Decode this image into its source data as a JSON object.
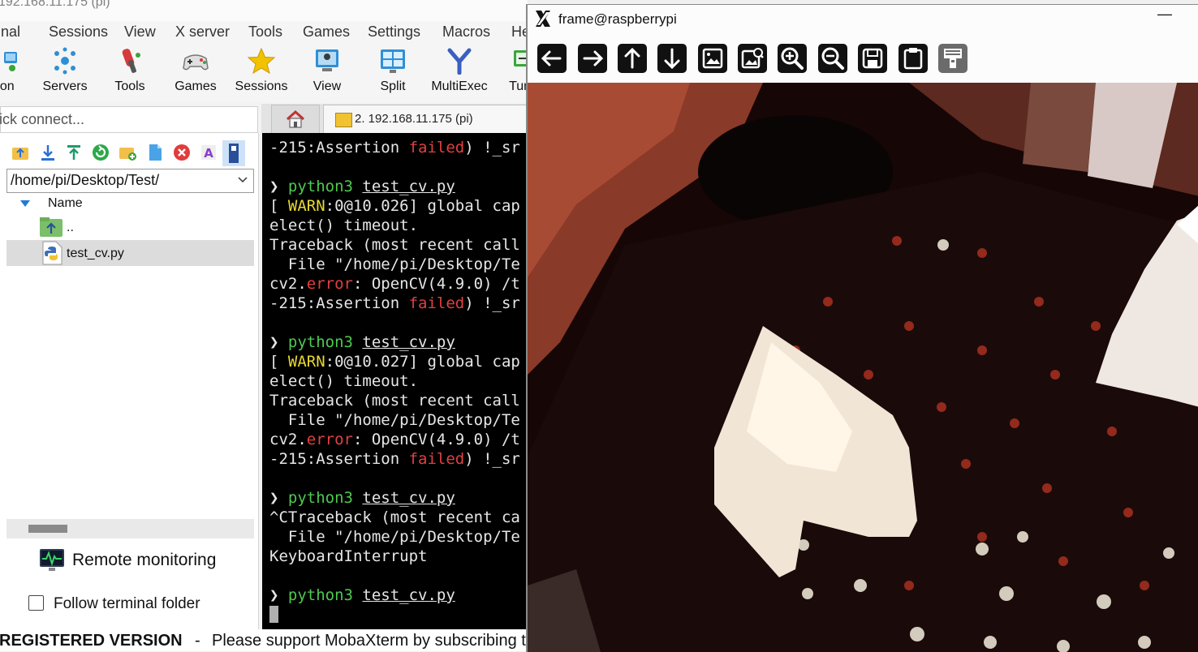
{
  "moba": {
    "title": "192.168.11.175 (pi)",
    "menu": [
      "inal",
      "Sessions",
      "View",
      "X server",
      "Tools",
      "Games",
      "Settings",
      "Macros",
      "He"
    ],
    "ribbon": [
      {
        "label": "sion",
        "icon": "session-icon"
      },
      {
        "label": "Servers",
        "icon": "servers-icon"
      },
      {
        "label": "Tools",
        "icon": "tools-icon"
      },
      {
        "label": "Games",
        "icon": "games-icon"
      },
      {
        "label": "Sessions",
        "icon": "sessions-star-icon"
      },
      {
        "label": "View",
        "icon": "view-icon"
      },
      {
        "label": "Split",
        "icon": "split-icon"
      },
      {
        "label": "MultiExec",
        "icon": "multiexec-icon"
      },
      {
        "label": "Tunn",
        "icon": "tunneling-icon"
      }
    ],
    "quick_connect_placeholder": "ick connect...",
    "tab_label": "2. 192.168.11.175 (pi)",
    "sftp": {
      "path": "/home/pi/Desktop/Test/",
      "column_name": "Name",
      "files": [
        {
          "name": "..",
          "icon": "parent-folder-icon"
        },
        {
          "name": "test_cv.py",
          "icon": "python-file-icon"
        }
      ],
      "remote_monitoring": "Remote monitoring",
      "follow_terminal_folder": "Follow terminal folder",
      "follow_checked": false
    },
    "status": {
      "registered": "REGISTERED VERSION",
      "sep": "-",
      "message": "Please support MobaXterm by subscribing to"
    }
  },
  "terminal": {
    "lines": [
      {
        "parts": [
          {
            "t": "-215:Assertion "
          },
          {
            "t": "failed",
            "c": "red"
          },
          {
            "t": ") !_sr"
          }
        ]
      },
      {
        "parts": [
          {
            "t": ""
          }
        ]
      },
      {
        "parts": [
          {
            "t": "❯ "
          },
          {
            "t": "python3",
            "c": "green"
          },
          {
            "t": " "
          },
          {
            "t": "test_cv.py",
            "c": "ul"
          }
        ]
      },
      {
        "parts": [
          {
            "t": "[ "
          },
          {
            "t": "WARN",
            "c": "yellow"
          },
          {
            "t": ":0@10.026] global cap"
          }
        ]
      },
      {
        "parts": [
          {
            "t": "elect() timeout."
          }
        ]
      },
      {
        "parts": [
          {
            "t": "Traceback (most recent call"
          }
        ]
      },
      {
        "parts": [
          {
            "t": "  File \"/home/pi/Desktop/Te"
          }
        ]
      },
      {
        "parts": [
          {
            "t": "cv2."
          },
          {
            "t": "error",
            "c": "red"
          },
          {
            "t": ": OpenCV(4.9.0) /t"
          }
        ]
      },
      {
        "parts": [
          {
            "t": "-215:Assertion "
          },
          {
            "t": "failed",
            "c": "red"
          },
          {
            "t": ") !_sr"
          }
        ]
      },
      {
        "parts": [
          {
            "t": ""
          }
        ]
      },
      {
        "parts": [
          {
            "t": "❯ "
          },
          {
            "t": "python3",
            "c": "green"
          },
          {
            "t": " "
          },
          {
            "t": "test_cv.py",
            "c": "ul"
          }
        ]
      },
      {
        "parts": [
          {
            "t": "[ "
          },
          {
            "t": "WARN",
            "c": "yellow"
          },
          {
            "t": ":0@10.027] global cap"
          }
        ]
      },
      {
        "parts": [
          {
            "t": "elect() timeout."
          }
        ]
      },
      {
        "parts": [
          {
            "t": "Traceback (most recent call"
          }
        ]
      },
      {
        "parts": [
          {
            "t": "  File \"/home/pi/Desktop/Te"
          }
        ]
      },
      {
        "parts": [
          {
            "t": "cv2."
          },
          {
            "t": "error",
            "c": "red"
          },
          {
            "t": ": OpenCV(4.9.0) /t"
          }
        ]
      },
      {
        "parts": [
          {
            "t": "-215:Assertion "
          },
          {
            "t": "failed",
            "c": "red"
          },
          {
            "t": ") !_sr"
          }
        ]
      },
      {
        "parts": [
          {
            "t": ""
          }
        ]
      },
      {
        "parts": [
          {
            "t": "❯ "
          },
          {
            "t": "python3",
            "c": "green"
          },
          {
            "t": " "
          },
          {
            "t": "test_cv.py",
            "c": "ul"
          }
        ]
      },
      {
        "parts": [
          {
            "t": "^CTraceback (most recent ca"
          }
        ]
      },
      {
        "parts": [
          {
            "t": "  File \"/home/pi/Desktop/Te"
          }
        ]
      },
      {
        "parts": [
          {
            "t": "KeyboardInterrupt"
          }
        ]
      },
      {
        "parts": [
          {
            "t": ""
          }
        ]
      },
      {
        "parts": [
          {
            "t": "❯ "
          },
          {
            "t": "python3",
            "c": "green"
          },
          {
            "t": " "
          },
          {
            "t": "test_cv.py",
            "c": "ul"
          }
        ]
      }
    ]
  },
  "xwin": {
    "title": "frame@raspberrypi",
    "minimize": "—",
    "toolbar": [
      {
        "name": "pan-left-button",
        "icon": "arrow-left-icon"
      },
      {
        "name": "pan-right-button",
        "icon": "arrow-right-icon"
      },
      {
        "name": "pan-up-button",
        "icon": "arrow-up-icon"
      },
      {
        "name": "pan-down-button",
        "icon": "arrow-down-icon"
      },
      {
        "name": "zoom-in-image-button",
        "icon": "image-icon"
      },
      {
        "name": "zoom-image-button",
        "icon": "image-zoom-icon"
      },
      {
        "name": "zoom-in-button",
        "icon": "zoom-in-icon"
      },
      {
        "name": "zoom-out-button",
        "icon": "zoom-out-icon"
      },
      {
        "name": "save-button",
        "icon": "save-icon"
      },
      {
        "name": "copy-clipboard-button",
        "icon": "clipboard-icon"
      },
      {
        "name": "properties-button",
        "icon": "properties-icon"
      }
    ]
  },
  "colors": {
    "terminal_bg": "#000000",
    "prompt_green": "#4ec94e",
    "error_red": "#e04040",
    "warn_yellow": "#e8d830"
  }
}
